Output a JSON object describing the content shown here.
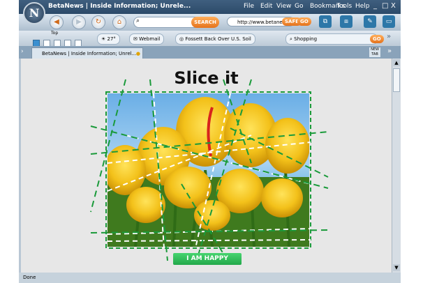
{
  "window": {
    "title": "BetaNews | Inside Information; Unrele...",
    "menu": [
      "File",
      "Edit",
      "View",
      "Go",
      "Bookmarks",
      "Tools",
      "Help"
    ],
    "controls": [
      "_",
      "□",
      "X"
    ]
  },
  "navbar": {
    "search_button": "SEARCH",
    "address": "http://www.betanews",
    "address_tag": "SAFE",
    "go_label": "GO"
  },
  "linkbar": {
    "top_label": "Top",
    "temp": "27°",
    "links": [
      "Webmail",
      "Fossett Back Over U.S. Soil",
      "Shopping"
    ],
    "go_label": "GO"
  },
  "tabs": [
    {
      "label": "BetaNews | Inside Information; Unrel..."
    }
  ],
  "content": {
    "heading": "Slice it",
    "button_label": "I AM HAPPY"
  },
  "status": {
    "text": "Done"
  },
  "colors": {
    "accent_green": "#2bb24c",
    "slice_line": "#1a9a3a",
    "orange": "#e5731c"
  }
}
